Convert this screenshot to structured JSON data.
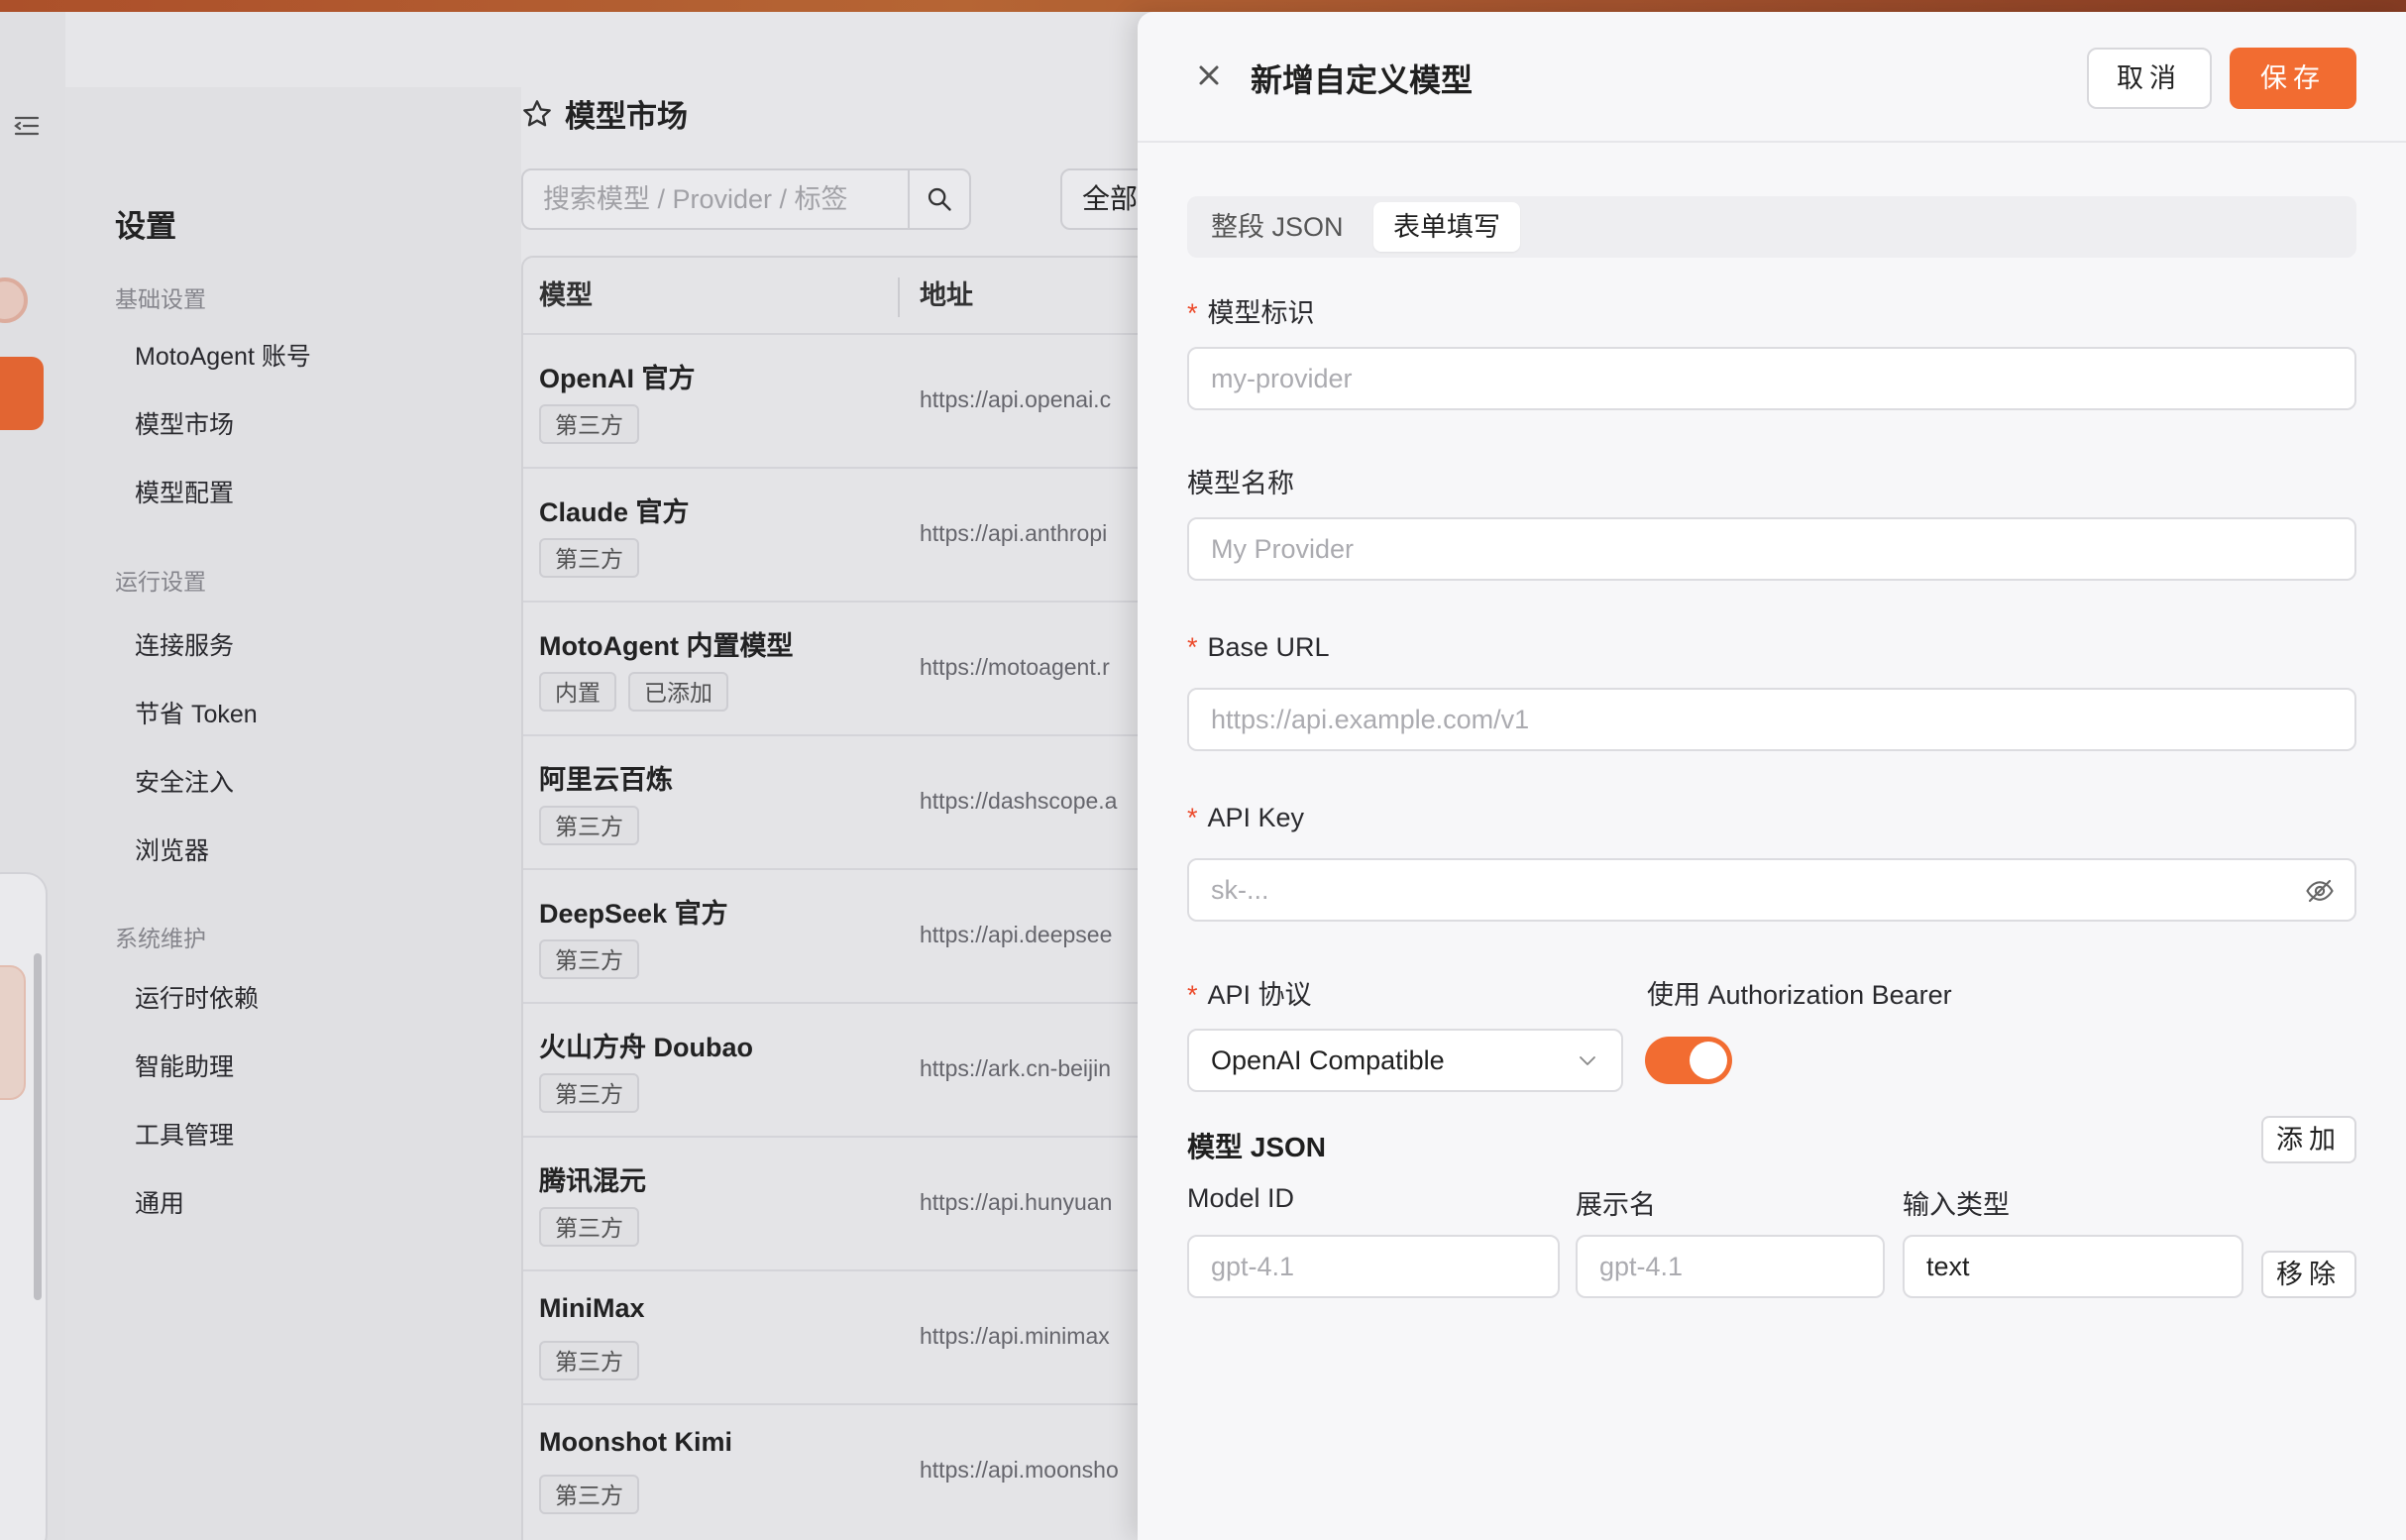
{
  "settings": {
    "title": "设置",
    "sections": [
      {
        "label": "基础设置",
        "items": [
          "MotoAgent 账号",
          "模型市场",
          "模型配置"
        ]
      },
      {
        "label": "运行设置",
        "items": [
          "连接服务",
          "节省 Token",
          "安全注入",
          "浏览器"
        ]
      },
      {
        "label": "系统维护",
        "items": [
          "运行时依赖",
          "智能助理",
          "工具管理",
          "通用"
        ]
      }
    ]
  },
  "market": {
    "title": "模型市场",
    "search_placeholder": "搜索模型 / Provider / 标签",
    "filter_label": "全部",
    "columns": [
      "模型",
      "地址"
    ],
    "rows": [
      {
        "name": "OpenAI 官方",
        "tags": [
          "第三方"
        ],
        "url": "https://api.openai.c"
      },
      {
        "name": "Claude 官方",
        "tags": [
          "第三方"
        ],
        "url": "https://api.anthropi"
      },
      {
        "name": "MotoAgent 内置模型",
        "tags": [
          "内置",
          "已添加"
        ],
        "url": "https://motoagent.r"
      },
      {
        "name": "阿里云百炼",
        "tags": [
          "第三方"
        ],
        "url": "https://dashscope.a"
      },
      {
        "name": "DeepSeek 官方",
        "tags": [
          "第三方"
        ],
        "url": "https://api.deepsee"
      },
      {
        "name": "火山方舟 Doubao",
        "tags": [
          "第三方"
        ],
        "url": "https://ark.cn-beijin"
      },
      {
        "name": "腾讯混元",
        "tags": [
          "第三方"
        ],
        "url": "https://api.hunyuan"
      },
      {
        "name": "MiniMax",
        "tags": [
          "第三方"
        ],
        "url": "https://api.minimax"
      },
      {
        "name": "Moonshot Kimi",
        "tags": [
          "第三方"
        ],
        "url": "https://api.moonsho"
      }
    ]
  },
  "drawer": {
    "title": "新增自定义模型",
    "cancel_label": "取消",
    "save_label": "保存",
    "tabs": [
      "整段 JSON",
      "表单填写"
    ],
    "active_tab": "表单填写",
    "fields": {
      "model_id": {
        "label": "模型标识",
        "placeholder": "my-provider",
        "required": true
      },
      "model_name": {
        "label": "模型名称",
        "placeholder": "My Provider",
        "required": false
      },
      "base_url": {
        "label": "Base URL",
        "placeholder": "https://api.example.com/v1",
        "required": true
      },
      "api_key": {
        "label": "API Key",
        "placeholder": "sk-...",
        "required": true
      },
      "api_protocol": {
        "label": "API 协议",
        "value": "OpenAI Compatible",
        "required": true
      },
      "auth_bearer": {
        "label": "使用 Authorization Bearer",
        "enabled": true
      }
    },
    "models_json": {
      "title": "模型 JSON",
      "add_label": "添加",
      "columns": [
        "Model ID",
        "展示名",
        "输入类型"
      ],
      "row": {
        "model_id_placeholder": "gpt-4.1",
        "display_name_placeholder": "gpt-4.1",
        "input_type": "text"
      },
      "remove_label": "移除"
    }
  },
  "colors": {
    "accent": "#f26c31",
    "required": "#ec4a2b",
    "drawer_bg": "#f7f7f9"
  }
}
